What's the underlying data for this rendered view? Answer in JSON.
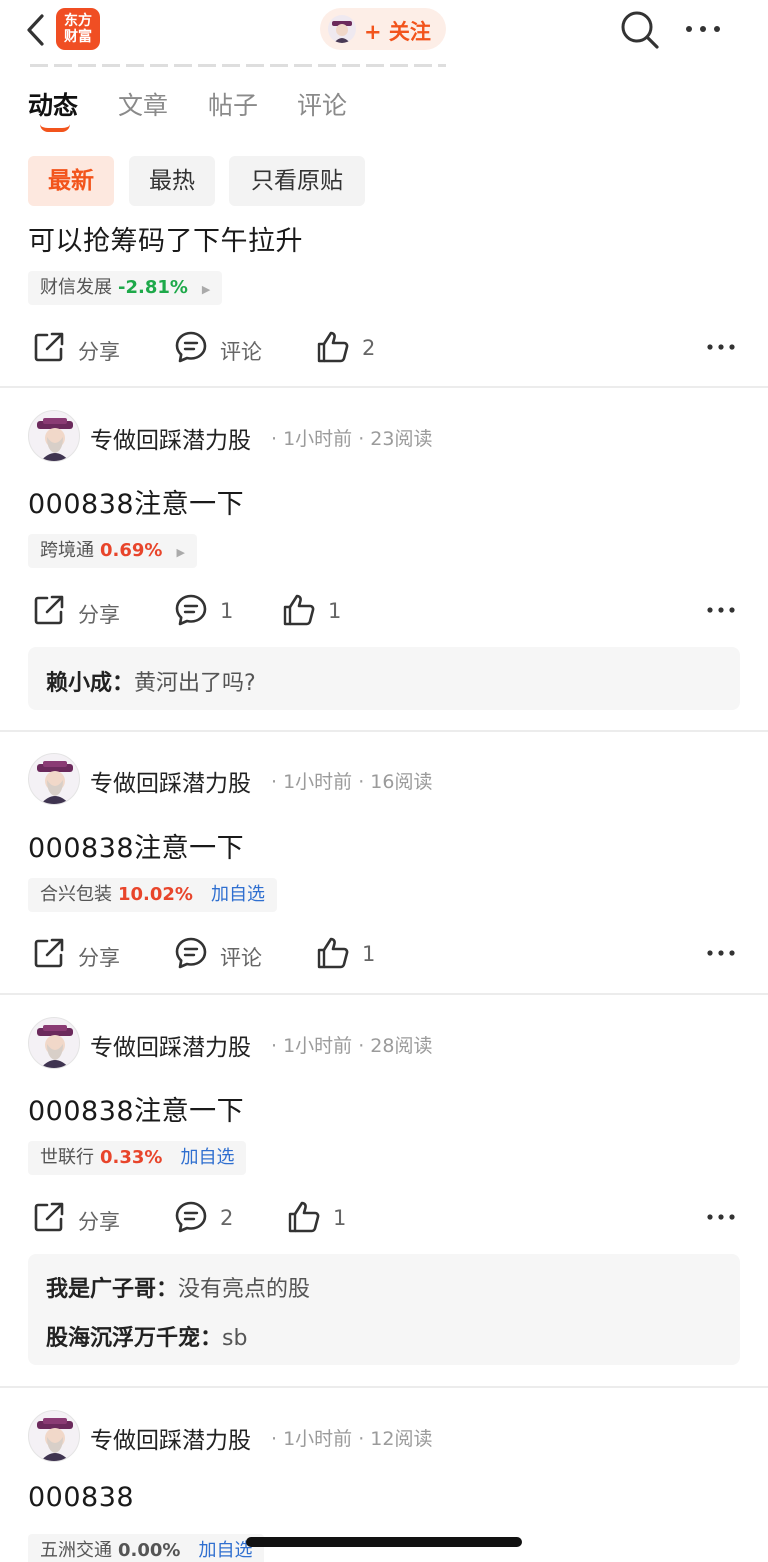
{
  "header": {
    "back_icon": "chevron-left-icon",
    "logo_text": "东方财富",
    "follow_label": "+ 关注",
    "search_icon": "search-icon",
    "more_icon": "more-icon"
  },
  "tabs": [
    {
      "label": "动态",
      "active": true
    },
    {
      "label": "文章",
      "active": false
    },
    {
      "label": "帖子",
      "active": false
    },
    {
      "label": "评论",
      "active": false
    }
  ],
  "filters": [
    {
      "label": "最新",
      "active": true
    },
    {
      "label": "最热",
      "active": false
    },
    {
      "label": "只看原贴",
      "active": false
    }
  ],
  "colors": {
    "accent": "#f2541c",
    "up": "#e8452b",
    "down": "#1ea94a",
    "link": "#2f6fd0"
  },
  "posts": [
    {
      "text": "可以抢筹码了下午拉升",
      "stock": {
        "name": "财信发展",
        "change": "-2.81%"
      },
      "actions": {
        "share": "分享",
        "comment": "评论",
        "like": "2"
      }
    },
    {
      "author": "专做回踩潜力股",
      "time": "· 1小时前",
      "reads": "· 23阅读",
      "text": "000838注意一下",
      "stock": {
        "name": "跨境通",
        "change": "0.69%"
      },
      "actions": {
        "share": "分享",
        "comment": "1",
        "like": "1"
      },
      "comments": [
        {
          "user": "赖小成：",
          "text": "黄河出了吗?"
        }
      ]
    },
    {
      "author": "专做回踩潜力股",
      "time": "· 1小时前",
      "reads": "· 16阅读",
      "text": "000838注意一下",
      "stock": {
        "name": "合兴包装",
        "change": "10.02%",
        "add": "加自选"
      },
      "actions": {
        "share": "分享",
        "comment": "评论",
        "like": "1"
      }
    },
    {
      "author": "专做回踩潜力股",
      "time": "· 1小时前",
      "reads": "· 28阅读",
      "text": "000838注意一下",
      "stock": {
        "name": "世联行",
        "change": "0.33%",
        "add": "加自选"
      },
      "actions": {
        "share": "分享",
        "comment": "2",
        "like": "1"
      },
      "comments": [
        {
          "user": "我是广子哥：",
          "text": "没有亮点的股"
        },
        {
          "user": "股海沉浮万千宠：",
          "text": "sb"
        }
      ]
    },
    {
      "author": "专做回踩潜力股",
      "time": "· 1小时前",
      "reads": "· 12阅读",
      "text": "000838",
      "stock": {
        "name": "五洲交通",
        "change": "0.00%",
        "add": "加自选"
      }
    }
  ]
}
